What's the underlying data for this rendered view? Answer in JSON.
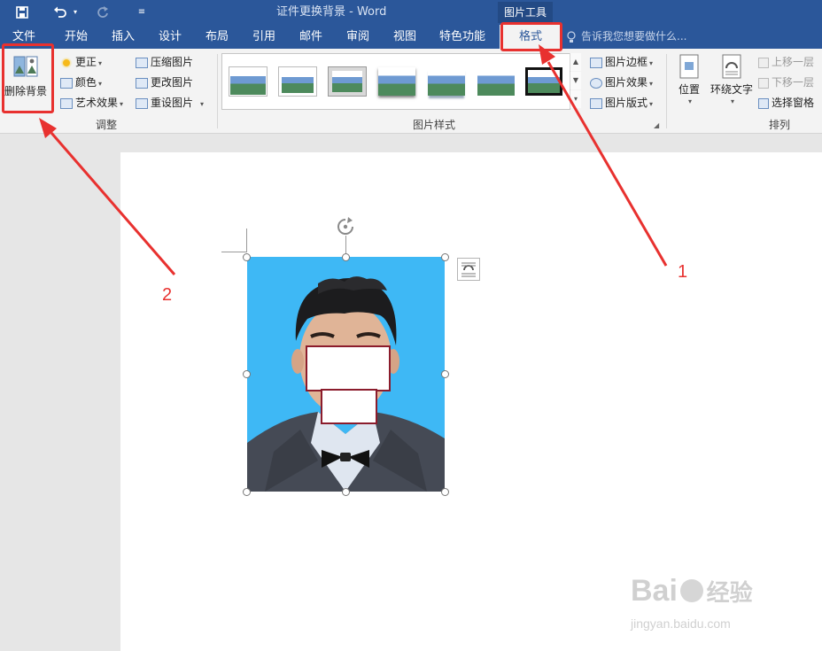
{
  "titlebar": {
    "title": "证件更换背景 - Word",
    "context_tab_group": "图片工具"
  },
  "menu": {
    "tabs": [
      {
        "label": "文件"
      },
      {
        "label": "开始"
      },
      {
        "label": "插入"
      },
      {
        "label": "设计"
      },
      {
        "label": "布局"
      },
      {
        "label": "引用"
      },
      {
        "label": "邮件"
      },
      {
        "label": "审阅"
      },
      {
        "label": "视图"
      },
      {
        "label": "特色功能"
      },
      {
        "label": "格式"
      }
    ],
    "tell_me": "告诉我您想要做什么..."
  },
  "ribbon": {
    "adjust": {
      "remove_bg": "删除背景",
      "corrections": "更正",
      "color": "颜色",
      "artistic": "艺术效果",
      "compress": "压缩图片",
      "change": "更改图片",
      "reset": "重设图片",
      "group_label": "调整"
    },
    "styles": {
      "group_label": "图片样式",
      "border": "图片边框",
      "effects": "图片效果",
      "layout": "图片版式"
    },
    "arrange": {
      "position": "位置",
      "wrap_text": "环绕文字",
      "bring_forward": "上移一层",
      "send_backward": "下移一层",
      "selection_pane": "选择窗格",
      "group_label": "排列"
    }
  },
  "annotations": {
    "step1": "1",
    "step2": "2"
  },
  "watermark": {
    "brand": "Bai",
    "brand2": "经验",
    "url": "jingyan.baidu.com"
  },
  "colors": {
    "accent": "#2b579a",
    "annotation_red": "#e8312f",
    "photo_background": "#3eb8f5"
  }
}
